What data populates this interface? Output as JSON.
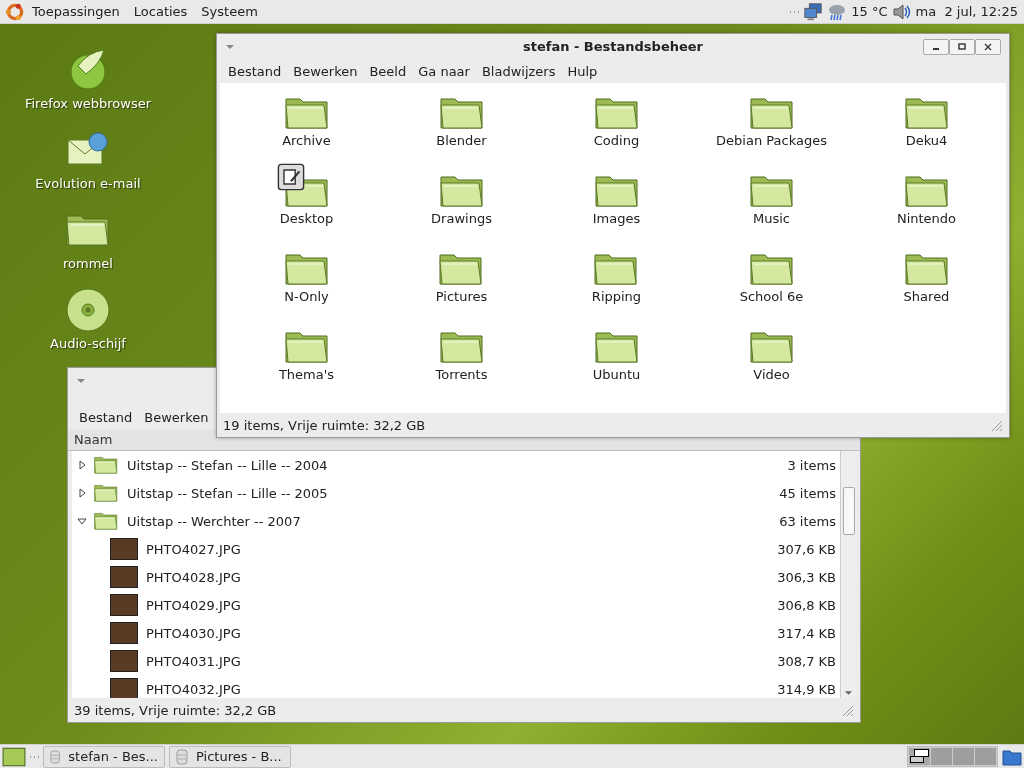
{
  "top_panel": {
    "menus": [
      "Toepassingen",
      "Locaties",
      "Systeem"
    ],
    "weather": "15 °C",
    "clock": "ma  2 jul, 12:25"
  },
  "desktop_icons": [
    {
      "kind": "browser",
      "label": "Firefox webbrowser"
    },
    {
      "kind": "mail",
      "label": "Evolution e-mail"
    },
    {
      "kind": "folder",
      "label": "rommel"
    },
    {
      "kind": "disc",
      "label": "Audio-schijf"
    }
  ],
  "back_window": {
    "menus": [
      "Bestand",
      "Bewerken"
    ],
    "column": "Naam",
    "rows": [
      {
        "name": "Uitstap -- Stefan -- Lille -- 2004",
        "size": "3 items",
        "expanded": false,
        "children": []
      },
      {
        "name": "Uitstap -- Stefan -- Lille -- 2005",
        "size": "45 items",
        "expanded": false,
        "children": []
      },
      {
        "name": "Uitstap -- Werchter -- 2007",
        "size": "63 items",
        "expanded": true,
        "children": [
          {
            "name": "PHTO4027.JPG",
            "size": "307,6 KB"
          },
          {
            "name": "PHTO4028.JPG",
            "size": "306,3 KB"
          },
          {
            "name": "PHTO4029.JPG",
            "size": "306,8 KB"
          },
          {
            "name": "PHTO4030.JPG",
            "size": "317,4 KB"
          },
          {
            "name": "PHTO4031.JPG",
            "size": "308,7 KB"
          },
          {
            "name": "PHTO4032.JPG",
            "size": "314,9 KB"
          }
        ]
      }
    ],
    "status": "39 items, Vrije ruimte: 32,2 GB"
  },
  "front_window": {
    "title": "stefan - Bestandsbeheer",
    "menus": [
      "Bestand",
      "Bewerken",
      "Beeld",
      "Ga naar",
      "Bladwijzers",
      "Hulp"
    ],
    "items": [
      {
        "label": "Archive",
        "emblem": false
      },
      {
        "label": "Blender",
        "emblem": false
      },
      {
        "label": "Coding",
        "emblem": false
      },
      {
        "label": "Debian Packages",
        "emblem": false
      },
      {
        "label": "Deku4",
        "emblem": false
      },
      {
        "label": "Desktop",
        "emblem": true
      },
      {
        "label": "Drawings",
        "emblem": false
      },
      {
        "label": "Images",
        "emblem": false
      },
      {
        "label": "Music",
        "emblem": false
      },
      {
        "label": "Nintendo",
        "emblem": false
      },
      {
        "label": "N-Only",
        "emblem": false
      },
      {
        "label": "Pictures",
        "emblem": false
      },
      {
        "label": "Ripping",
        "emblem": false
      },
      {
        "label": "School 6e",
        "emblem": false
      },
      {
        "label": "Shared",
        "emblem": false
      },
      {
        "label": "Thema's",
        "emblem": false
      },
      {
        "label": "Torrents",
        "emblem": false
      },
      {
        "label": "Ubuntu",
        "emblem": false
      },
      {
        "label": "Video",
        "emblem": false
      }
    ],
    "status": "19 items, Vrije ruimte: 32,2 GB"
  },
  "taskbar": {
    "tasks": [
      {
        "label": "stefan - Bes...",
        "selected": false
      },
      {
        "label": "Pictures - B...",
        "selected": false
      }
    ],
    "workspaces": [
      {
        "selected": true
      },
      {
        "selected": false
      },
      {
        "selected": false
      },
      {
        "selected": false
      }
    ]
  }
}
